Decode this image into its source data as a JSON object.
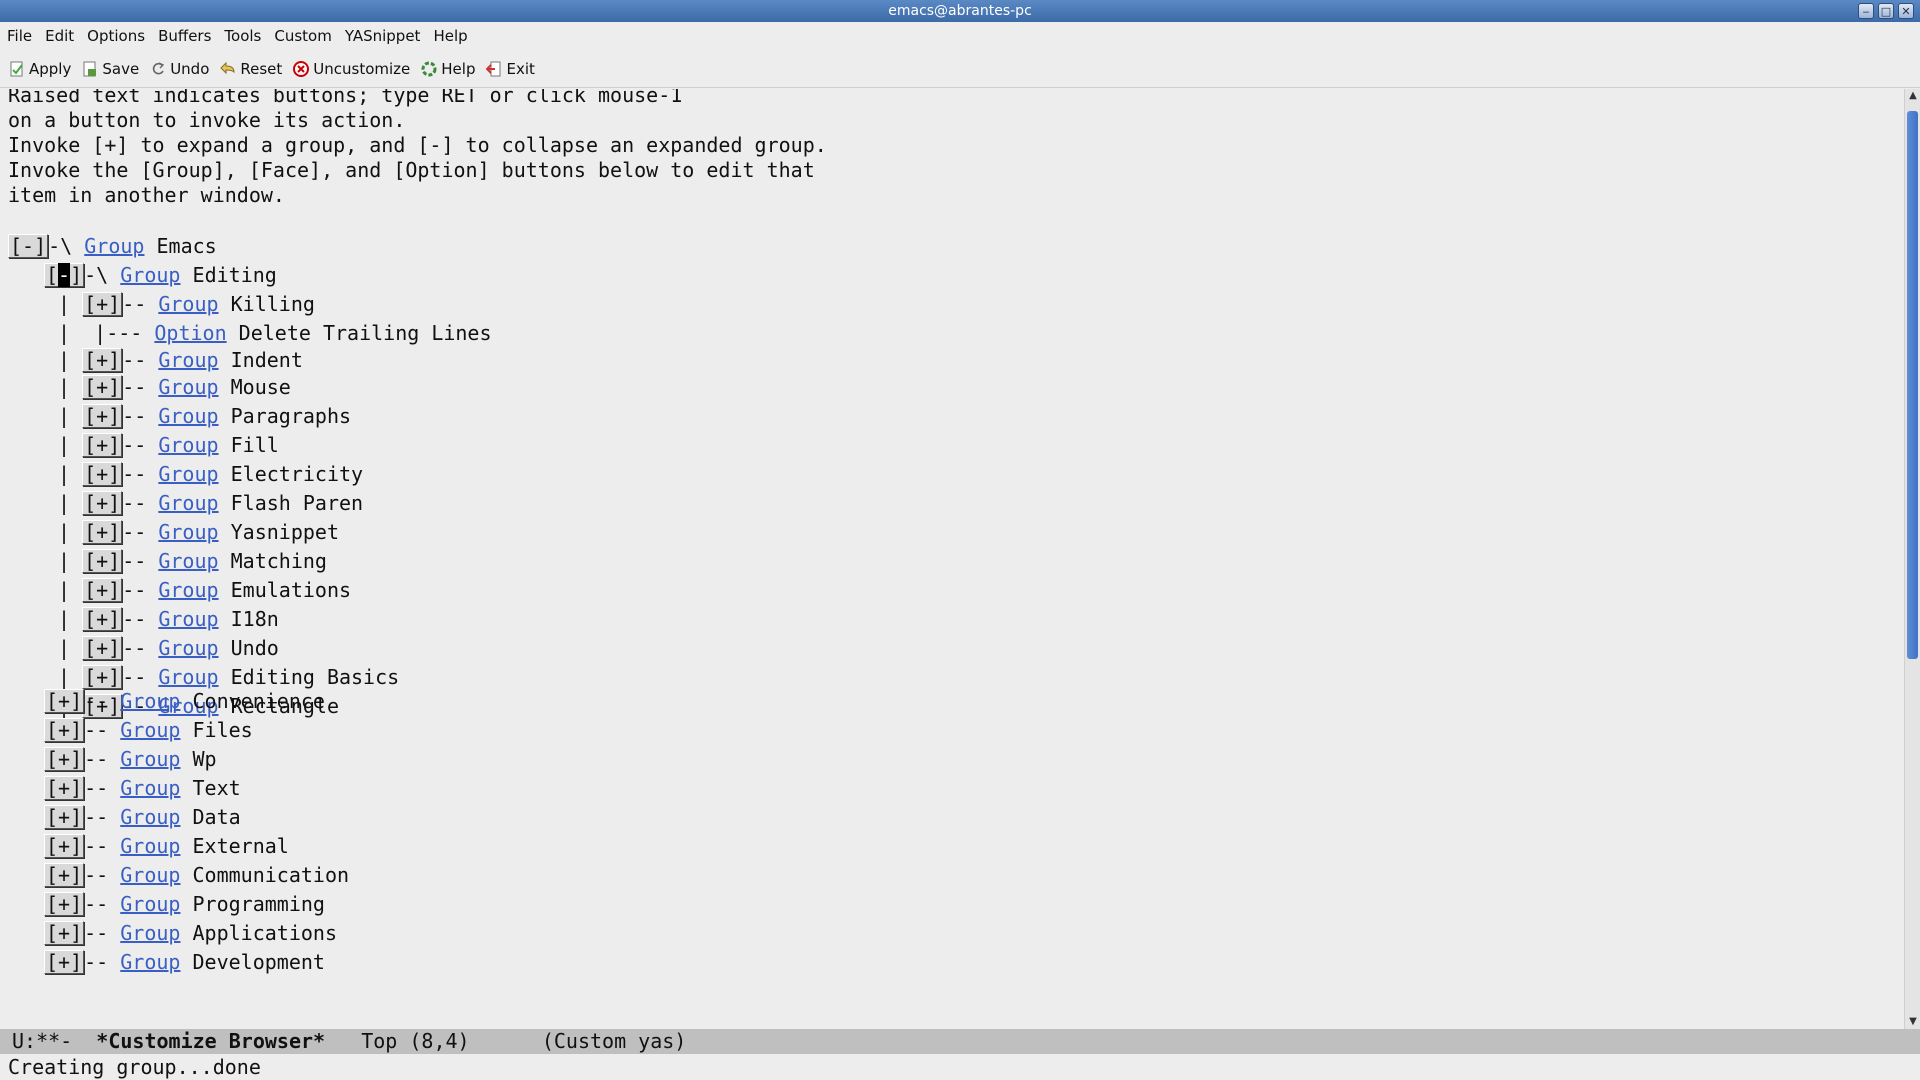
{
  "window": {
    "title": "emacs@abrantes-pc"
  },
  "menubar": [
    "File",
    "Edit",
    "Options",
    "Buffers",
    "Tools",
    "Custom",
    "YASnippet",
    "Help"
  ],
  "toolbar": {
    "apply": "Apply",
    "save": "Save",
    "undo": "Undo",
    "reset": "Reset",
    "uncustomize": "Uncustomize",
    "help": "Help",
    "exit": "Exit"
  },
  "intro": [
    "Raised text indicates buttons; type RET or click mouse-1",
    "on a button to invoke its action.",
    "Invoke [+] to expand a group, and [-] to collapse an expanded group.",
    "Invoke the [Group], [Face], and [Option] buttons below to edit that",
    "item in another window."
  ],
  "tree": {
    "root": {
      "toggle": "[-]",
      "connector": "-\\ ",
      "type": "Group",
      "name": "Emacs"
    },
    "editing": {
      "toggle_left": "[",
      "toggle_cursor": "-",
      "toggle_right": "]",
      "connector": "-\\ ",
      "type": "Group",
      "name": "Editing"
    },
    "editing_children": [
      {
        "kind": "group",
        "name": "Killing"
      },
      {
        "kind": "option",
        "name": "Delete Trailing Lines"
      },
      {
        "kind": "group",
        "name": "Indent"
      },
      {
        "kind": "group",
        "name": "Mouse"
      },
      {
        "kind": "group",
        "name": "Paragraphs"
      },
      {
        "kind": "group",
        "name": "Fill"
      },
      {
        "kind": "group",
        "name": "Electricity"
      },
      {
        "kind": "group",
        "name": "Flash Paren"
      },
      {
        "kind": "group",
        "name": "Yasnippet"
      },
      {
        "kind": "group",
        "name": "Matching"
      },
      {
        "kind": "group",
        "name": "Emulations"
      },
      {
        "kind": "group",
        "name": "I18n"
      },
      {
        "kind": "group",
        "name": "Undo"
      },
      {
        "kind": "group",
        "name": "Editing Basics"
      },
      {
        "kind": "group",
        "name": "Rectangle"
      }
    ],
    "top_groups": [
      "Convenience",
      "Files",
      "Wp",
      "Text",
      "Data",
      "External",
      "Communication",
      "Programming",
      "Applications",
      "Development"
    ],
    "expand_label": "[+]",
    "group_label": "Group",
    "option_label": "Option",
    "group_connector": "-- ",
    "option_connector": "--- "
  },
  "modeline": {
    "status": "U:**-  ",
    "buffer": "*Customize Browser*",
    "position": "   Top (8,4)      ",
    "mode": "(Custom yas)"
  },
  "echo": "Creating group...done",
  "icons": {
    "apply": "apply-icon",
    "save": "save-icon",
    "undo": "undo-icon",
    "reset": "reset-icon",
    "uncustomize": "uncustomize-icon",
    "help": "help-icon",
    "exit": "exit-icon"
  },
  "colors": {
    "link": "#3a5fc4",
    "titlebar": "#3d6aa8",
    "scroll_thumb": "#4a7fd0",
    "modeline": "#bfbfbf"
  }
}
